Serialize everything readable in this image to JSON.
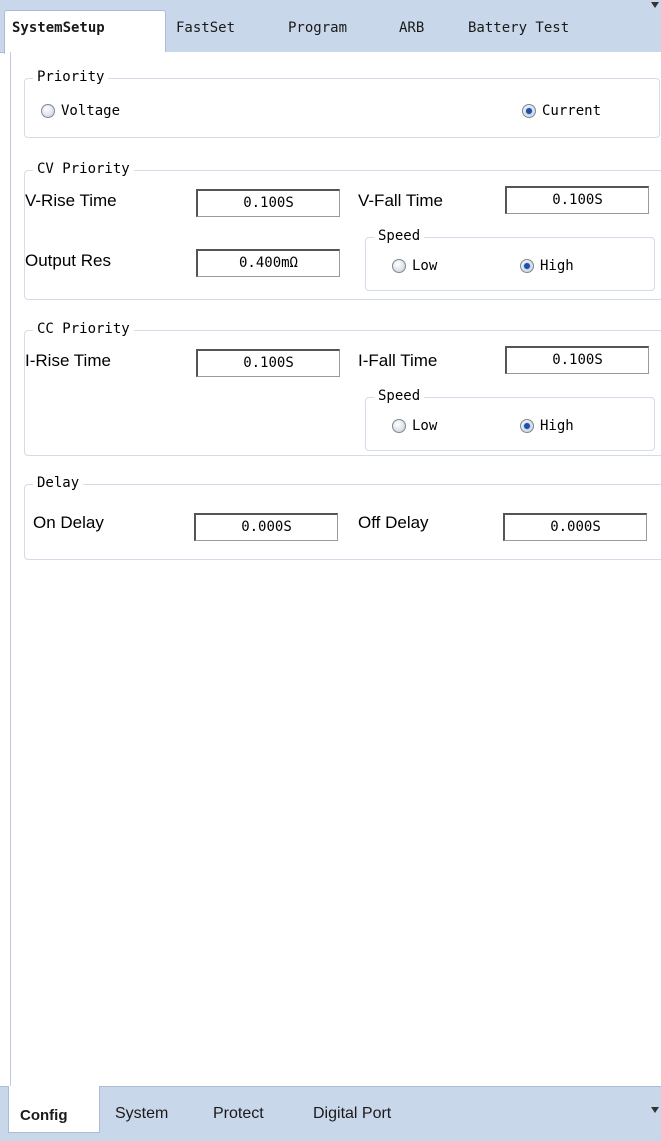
{
  "top_tabs": [
    "SystemSetup",
    "FastSet",
    "Program",
    "ARB",
    "Battery Test"
  ],
  "priority": {
    "title": "Priority",
    "voltage_label": "Voltage",
    "current_label": "Current",
    "selected": "Current"
  },
  "cv": {
    "title": "CV Priority",
    "rise_label": "V-Rise Time",
    "rise_value": "0.100S",
    "fall_label": "V-Fall Time",
    "fall_value": "0.100S",
    "res_label": "Output Res",
    "res_value": "0.400mΩ",
    "speed_title": "Speed",
    "speed_low": "Low",
    "speed_high": "High",
    "speed_selected": "High"
  },
  "cc": {
    "title": "CC Priority",
    "rise_label": "I-Rise Time",
    "rise_value": "0.100S",
    "fall_label": "I-Fall Time",
    "fall_value": "0.100S",
    "speed_title": "Speed",
    "speed_low": "Low",
    "speed_high": "High",
    "speed_selected": "High"
  },
  "delay": {
    "title": "Delay",
    "on_label": "On Delay",
    "on_value": "0.000S",
    "off_label": "Off Delay",
    "off_value": "0.000S"
  },
  "bottom_tabs": [
    "Config",
    "System",
    "Protect",
    "Digital Port"
  ]
}
